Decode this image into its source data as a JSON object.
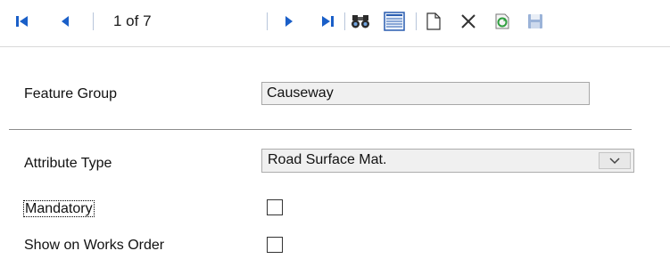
{
  "toolbar": {
    "first_icon": "first-record-icon",
    "prev_icon": "previous-record-icon",
    "record_position": "1 of 7",
    "next_icon": "next-record-icon",
    "last_icon": "last-record-icon",
    "find_icon": "binoculars-icon",
    "list_icon": "list-view-icon",
    "new_icon": "new-document-icon",
    "delete_icon": "delete-x-icon",
    "refresh_icon": "refresh-icon",
    "save_icon": "save-disk-icon",
    "accent_color": "#1a5fc8"
  },
  "form": {
    "feature_group": {
      "label": "Feature Group",
      "value": "Causeway"
    },
    "attribute_type": {
      "label": "Attribute Type",
      "value": "Road Surface Mat."
    },
    "mandatory": {
      "label": "Mandatory",
      "checked": false
    },
    "show_on_works_order": {
      "label": "Show on Works Order",
      "checked": false
    }
  }
}
